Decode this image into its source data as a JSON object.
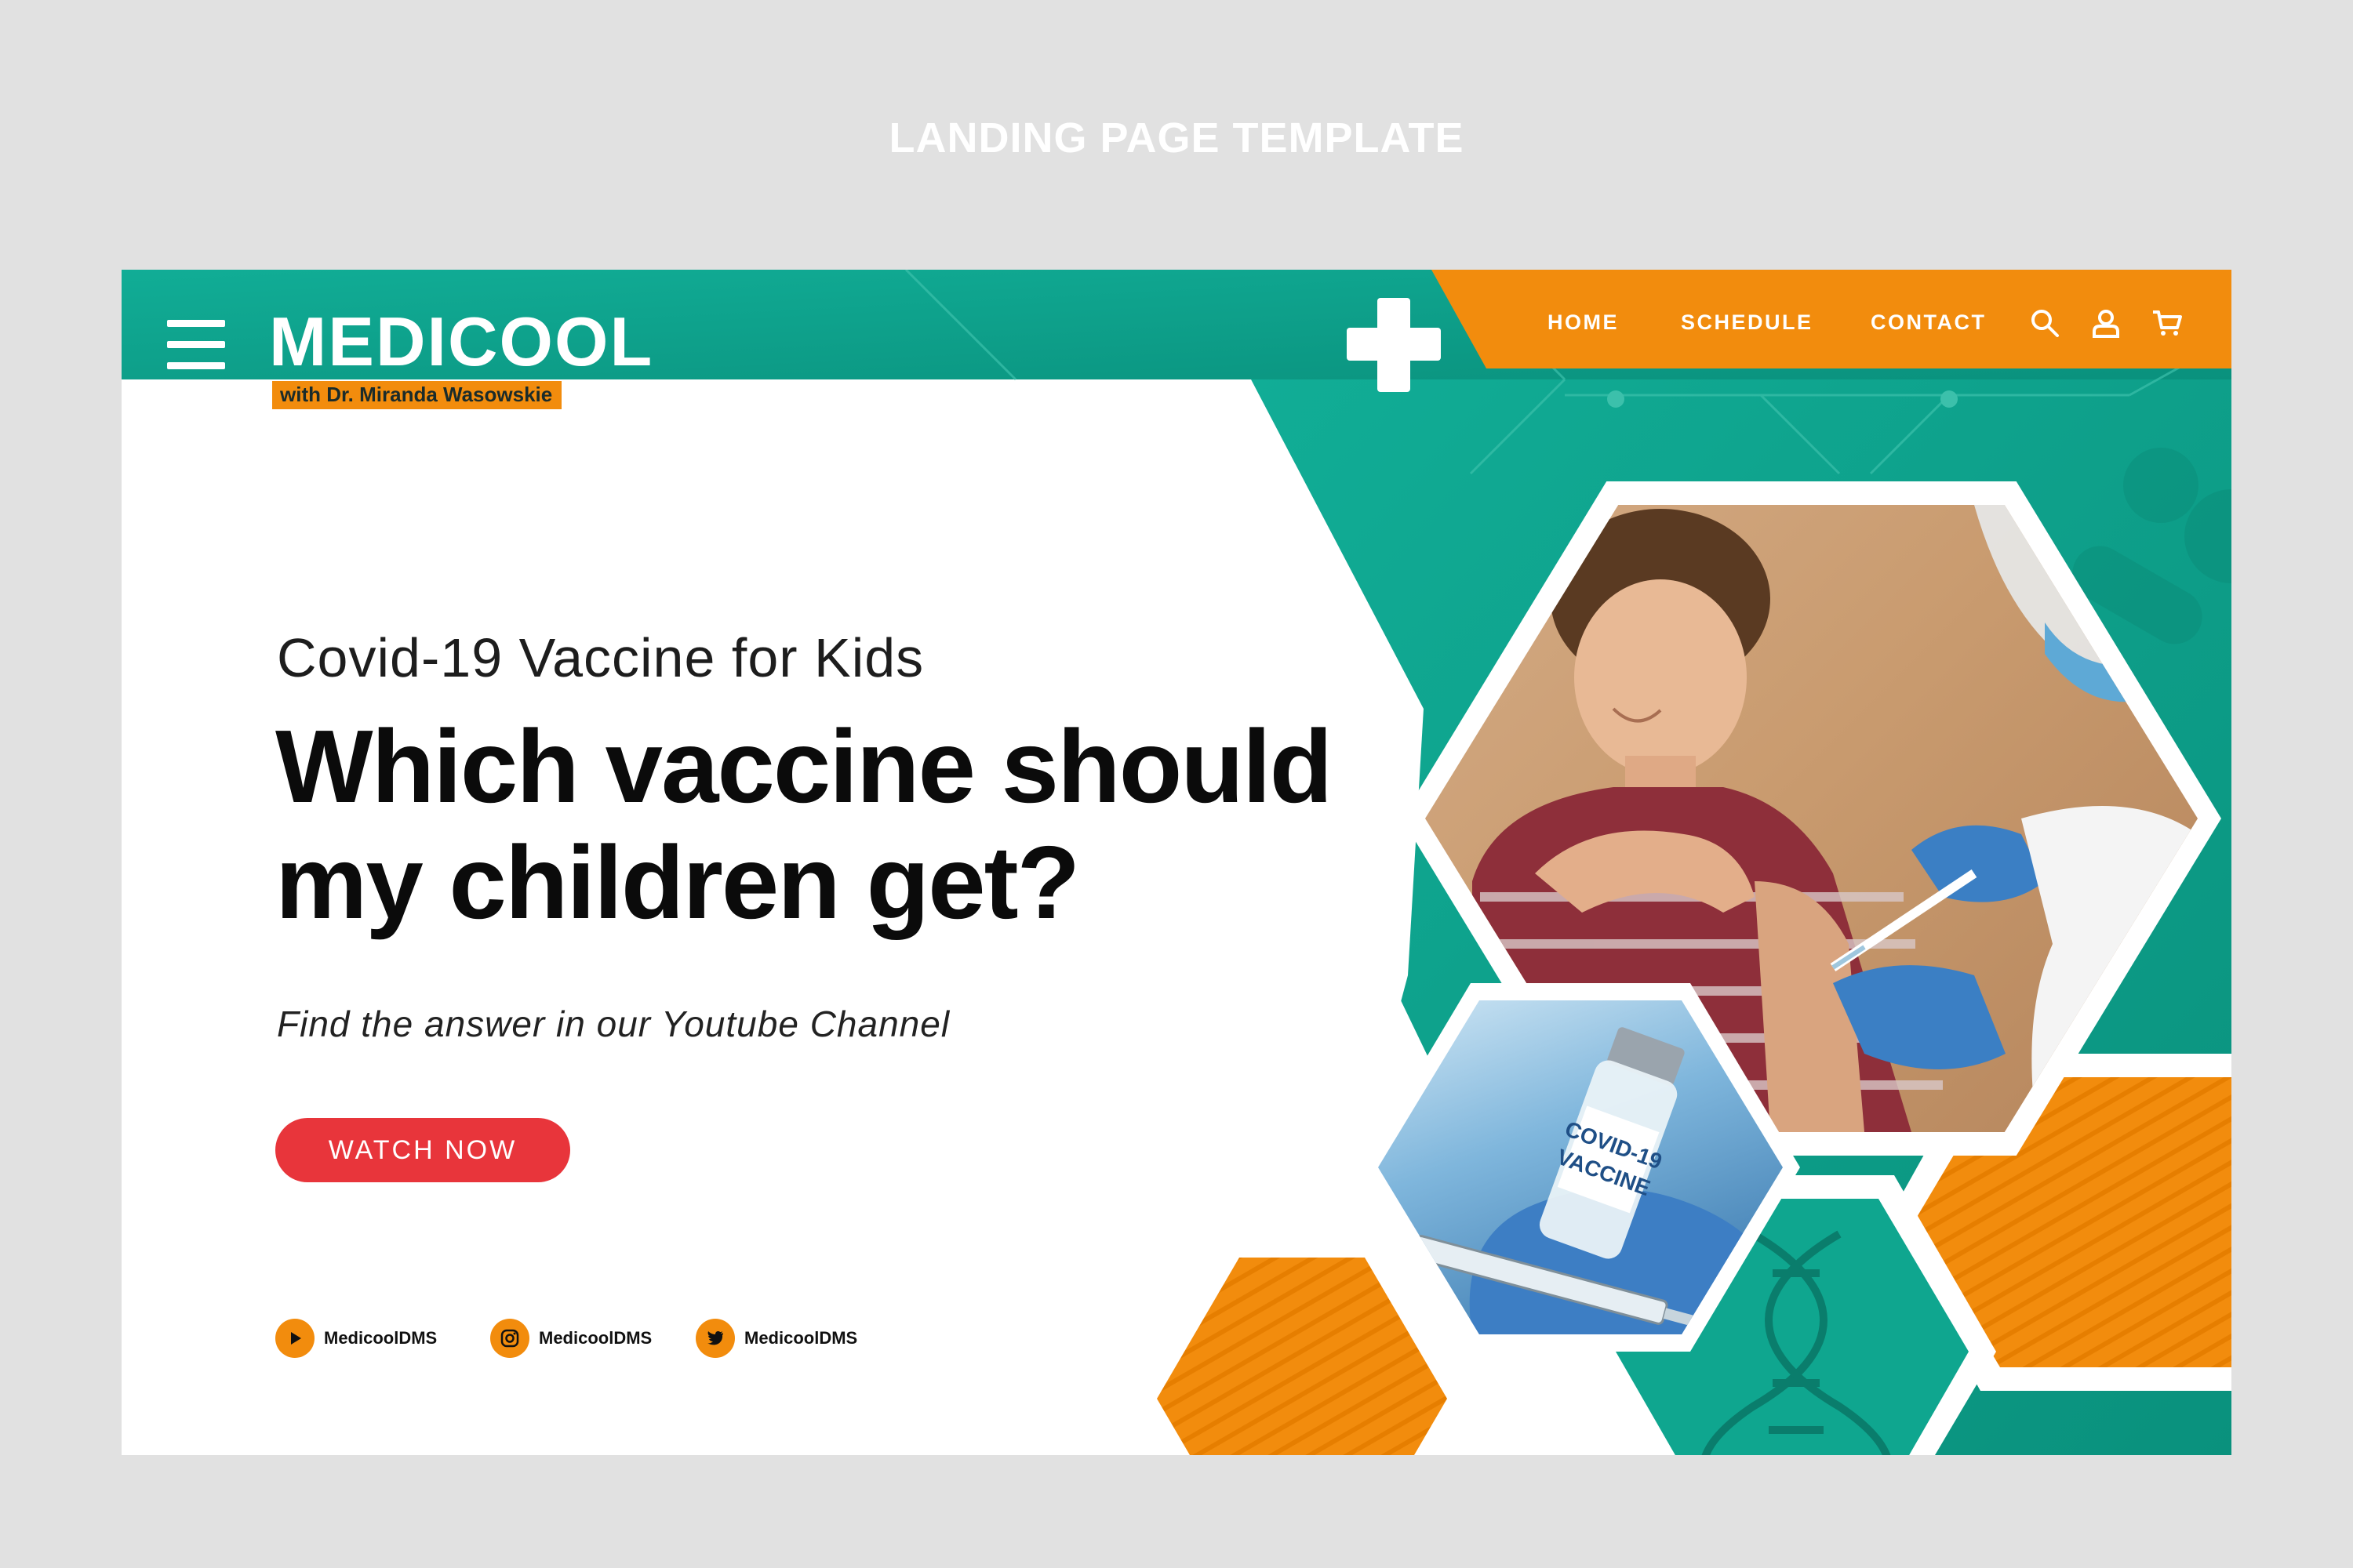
{
  "page_caption": "LANDING PAGE TEMPLATE",
  "brand": {
    "logo": "MEDICOOL",
    "tagline": "with Dr. Miranda Wasowskie"
  },
  "nav": {
    "links": [
      "HOME",
      "SCHEDULE",
      "CONTACT"
    ],
    "icons": [
      "search-icon",
      "user-icon",
      "cart-icon"
    ]
  },
  "hero": {
    "subtitle": "Covid-19 Vaccine for Kids",
    "headline": "Which vaccine should my children get?",
    "tagline": "Find the answer in our Youtube Channel",
    "cta_label": "WATCH NOW"
  },
  "social": [
    {
      "icon": "youtube-play-icon",
      "handle": "MedicoolDMS"
    },
    {
      "icon": "instagram-icon",
      "handle": "MedicoolDMS"
    },
    {
      "icon": "twitter-icon",
      "handle": "MedicoolDMS"
    }
  ],
  "photo_labels": {
    "vial_text": "COVID-19 VACCINE"
  },
  "colors": {
    "teal": "#0fa68f",
    "teal_dark": "#0b8c7a",
    "orange": "#f28c0d",
    "red_cta": "#e8353b",
    "page_bg": "#e1e1e1"
  }
}
